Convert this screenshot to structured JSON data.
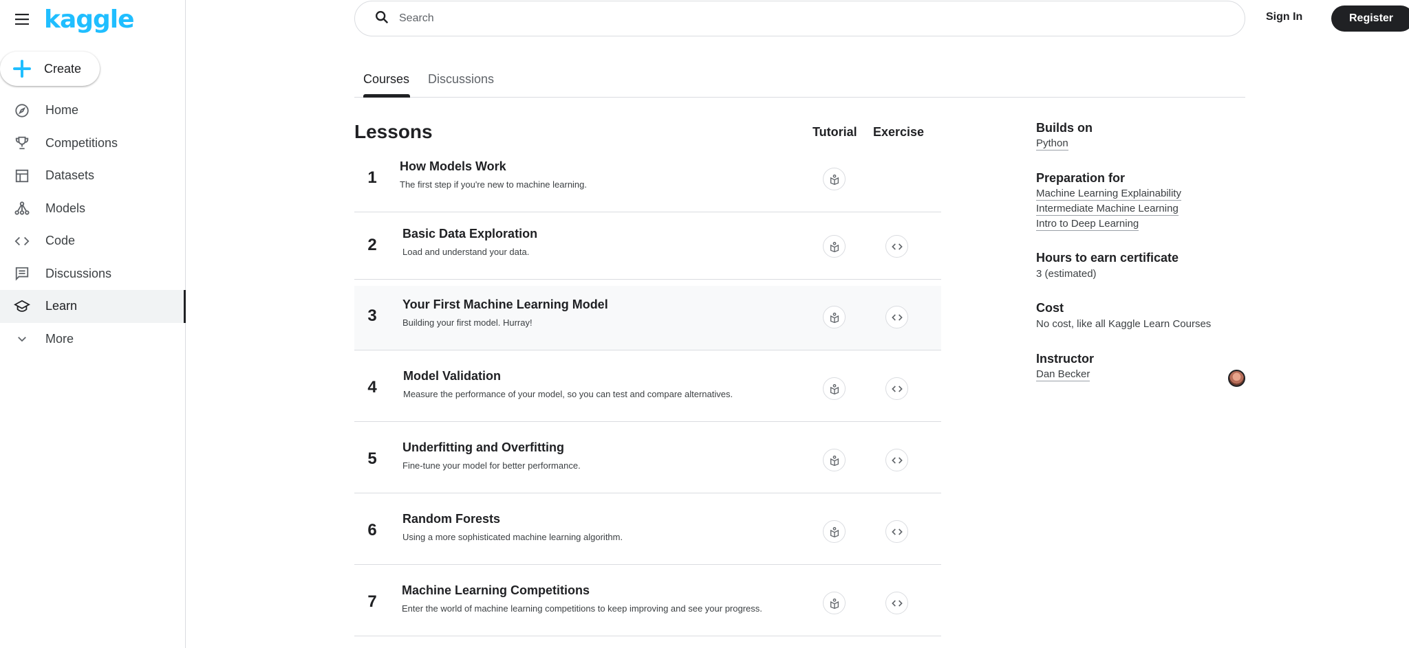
{
  "brand": {
    "logo": "kaggle"
  },
  "sidebar": {
    "create_label": "Create",
    "items": [
      {
        "label": "Home",
        "icon": "compass-icon"
      },
      {
        "label": "Competitions",
        "icon": "trophy-icon"
      },
      {
        "label": "Datasets",
        "icon": "table-icon"
      },
      {
        "label": "Models",
        "icon": "models-icon"
      },
      {
        "label": "Code",
        "icon": "code-icon"
      },
      {
        "label": "Discussions",
        "icon": "comment-icon"
      },
      {
        "label": "Learn",
        "icon": "school-icon",
        "active": true
      },
      {
        "label": "More",
        "icon": "chevron-down-icon"
      }
    ]
  },
  "header": {
    "search_placeholder": "Search",
    "signin_label": "Sign In",
    "register_label": "Register"
  },
  "tabs": [
    {
      "label": "Courses",
      "active": true
    },
    {
      "label": "Discussions",
      "active": false
    }
  ],
  "lessons": {
    "title": "Lessons",
    "col_tutorial": "Tutorial",
    "col_exercise": "Exercise",
    "items": [
      {
        "num": "1",
        "title": "How Models Work",
        "desc": "The first step if you're new to machine learning.",
        "has_exercise": false
      },
      {
        "num": "2",
        "title": "Basic Data Exploration",
        "desc": "Load and understand your data.",
        "has_exercise": true
      },
      {
        "num": "3",
        "title": "Your First Machine Learning Model",
        "desc": "Building your first model. Hurray!",
        "has_exercise": true
      },
      {
        "num": "4",
        "title": "Model Validation",
        "desc": "Measure the performance of your model, so you can test and compare alternatives.",
        "has_exercise": true
      },
      {
        "num": "5",
        "title": "Underfitting and Overfitting",
        "desc": "Fine-tune your model for better performance.",
        "has_exercise": true
      },
      {
        "num": "6",
        "title": "Random Forests",
        "desc": "Using a more sophisticated machine learning algorithm.",
        "has_exercise": true
      },
      {
        "num": "7",
        "title": "Machine Learning Competitions",
        "desc": "Enter the world of machine learning competitions to keep improving and see your progress.",
        "has_exercise": true
      }
    ]
  },
  "info": {
    "builds_on": {
      "heading": "Builds on",
      "links": [
        "Python"
      ]
    },
    "preparation": {
      "heading": "Preparation for",
      "links": [
        "Machine Learning Explainability",
        "Intermediate Machine Learning",
        "Intro to Deep Learning"
      ]
    },
    "hours": {
      "heading": "Hours to earn certificate",
      "value": "3 (estimated)"
    },
    "cost": {
      "heading": "Cost",
      "value": "No cost, like all Kaggle Learn Courses"
    },
    "instructor": {
      "heading": "Instructor",
      "name": "Dan Becker"
    }
  },
  "colors": {
    "brand": "#20beff",
    "dark": "#202124",
    "border": "#dadce0"
  }
}
